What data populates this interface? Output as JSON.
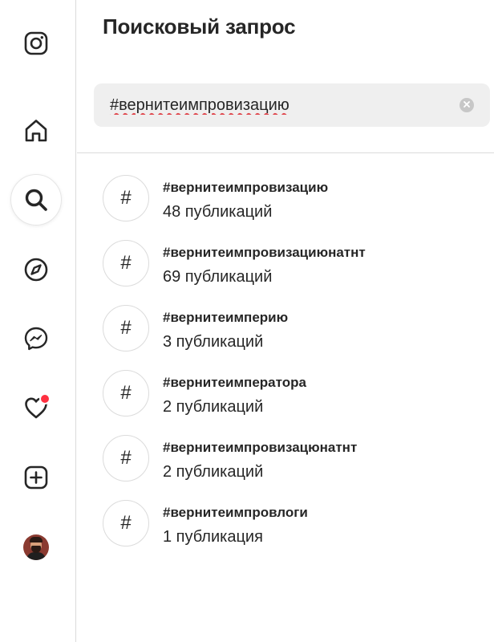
{
  "nav": {
    "items": [
      {
        "name": "instagram-logo",
        "icon": "instagram-icon"
      },
      {
        "name": "home",
        "icon": "home-icon"
      },
      {
        "name": "search",
        "icon": "search-icon",
        "active": true
      },
      {
        "name": "explore",
        "icon": "compass-icon"
      },
      {
        "name": "messages",
        "icon": "messenger-icon"
      },
      {
        "name": "notifications",
        "icon": "heart-icon",
        "badge": true
      },
      {
        "name": "create",
        "icon": "plus-square-icon"
      },
      {
        "name": "profile",
        "icon": "avatar"
      }
    ],
    "badge_color": "#ff3040"
  },
  "search_panel": {
    "title": "Поисковый запрос",
    "query": "#вернитеимпровизацию",
    "clear_icon": "clear-circle-icon"
  },
  "results": [
    {
      "tag": "#вернитеимпровизацию",
      "count": "48 публикаций",
      "icon": "hashtag-icon"
    },
    {
      "tag": "#вернитеимпровизациюнатнт",
      "count": "69 публикаций",
      "icon": "hashtag-icon"
    },
    {
      "tag": "#вернитеимперию",
      "count": "3 публикаций",
      "icon": "hashtag-icon"
    },
    {
      "tag": "#вернитеимператора",
      "count": "2 публикаций",
      "icon": "hashtag-icon"
    },
    {
      "tag": "#вернитеимпровизацюнатнт",
      "count": "2 публикаций",
      "icon": "hashtag-icon"
    },
    {
      "tag": "#вернитеимпровлоги",
      "count": "1 публикация",
      "icon": "hashtag-icon"
    }
  ]
}
